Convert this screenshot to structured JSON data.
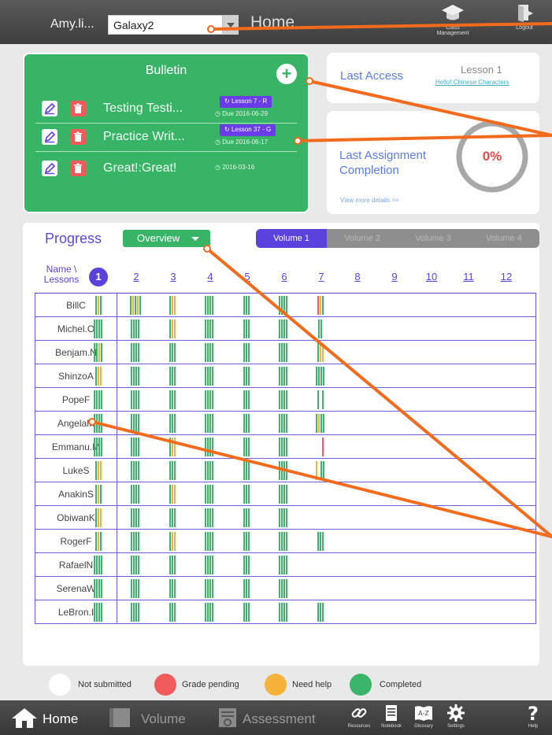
{
  "header": {
    "user_name": "Amy.li...",
    "class_select": "Galaxy2",
    "title": "Home",
    "class_management_label": "Class Management",
    "logout_label": "Logout"
  },
  "bulletin": {
    "title": "Bulletin",
    "add_label": "+",
    "items": [
      {
        "text": "Testing Testi...",
        "tag": "Lesson 7 - R",
        "due": "Due 2016-06-29"
      },
      {
        "text": "Practice Writ...",
        "tag": "Lesson 37 - G",
        "due": "Due 2016-06-17"
      },
      {
        "text": "Great!:Great!",
        "tag": "",
        "due": "2016-03-16"
      }
    ]
  },
  "last_access": {
    "label": "Last Access",
    "lesson": "Lesson 1",
    "link": "Hello! Chinese Characters"
  },
  "last_assignment": {
    "label": "Last Assignment Completion",
    "percent": "0%",
    "completion_fraction": 0,
    "more_link": "View more details >>"
  },
  "progress": {
    "title": "Progress",
    "view_select": "Overview",
    "volumes": [
      "Volume 1",
      "Volume 2",
      "Volume 3",
      "Volume 4"
    ],
    "active_volume": 0,
    "name_header": "Name \\ Lessons",
    "lessons": [
      "1",
      "2",
      "3",
      "4",
      "5",
      "6",
      "7",
      "8",
      "9",
      "10",
      "11",
      "12"
    ],
    "active_lesson": 0,
    "students": [
      {
        "name": "BillC",
        "bars": [
          "gyg",
          "gygyg",
          "gyy",
          "gggg",
          "ggg",
          "gggg",
          "ryg"
        ]
      },
      {
        "name": "Michel.O",
        "bars": [
          "gggg",
          "gggg",
          "gyy",
          "gggg",
          "ggg",
          "gggg",
          "gg"
        ]
      },
      {
        "name": "Benjam.N",
        "bars": [
          "ggyg",
          "gggg",
          "ggg",
          "gggg",
          "ggg",
          "gggg",
          "gyy"
        ]
      },
      {
        "name": "ShinzoA",
        "bars": [
          "gyy",
          "gggg",
          "ggg",
          "gggg",
          "ggg",
          "gggg",
          "gggg"
        ]
      },
      {
        "name": "PopeF",
        "bars": [
          "gggg",
          "gggg",
          "ggg",
          "gggg",
          "ggg",
          "gggg",
          "g-g"
        ]
      },
      {
        "name": "AngelaM",
        "bars": [
          "gggg",
          "gggg",
          "ggg",
          "gggg",
          "ggg",
          "gggg",
          "gygg"
        ]
      },
      {
        "name": "Emmanu.M",
        "bars": [
          "gggg",
          "gggg",
          "gyy",
          "gggg",
          "ggg",
          "gggg",
          "--r"
        ]
      },
      {
        "name": "LukeS",
        "bars": [
          "gyy",
          "gggg",
          "ggg",
          "gggg",
          "ggg",
          "gggg",
          "y-gg"
        ]
      },
      {
        "name": "AnakinS",
        "bars": [
          "gyg",
          "gggg",
          "gyy",
          "gggg",
          "ggg",
          "gggg",
          ""
        ]
      },
      {
        "name": "ObiwanK",
        "bars": [
          "gyy",
          "gggg",
          "ggg",
          "gggg",
          "ggg",
          "gggg",
          ""
        ]
      },
      {
        "name": "RogerF",
        "bars": [
          "gyg",
          "gggg",
          "gyy",
          "gggg",
          "ggg",
          "gggg",
          "ggg"
        ]
      },
      {
        "name": "RafaelN",
        "bars": [
          "gggg",
          "gggg",
          "ggg",
          "gggg",
          "ggg",
          "gggg",
          ""
        ]
      },
      {
        "name": "SerenaW",
        "bars": [
          "gggg",
          "gggg",
          "ggg",
          "gggg",
          "ggg",
          "gggg",
          ""
        ]
      },
      {
        "name": "LeBron.I",
        "bars": [
          "gggg",
          "gggg",
          "ggg",
          "gggg",
          "ggg",
          "gggg",
          "ggg"
        ]
      }
    ]
  },
  "legend": [
    {
      "label": "Not submitted",
      "color": "#ffffff"
    },
    {
      "label": "Grade pending",
      "color": "#f25b5b"
    },
    {
      "label": "Need help",
      "color": "#f6b33a"
    },
    {
      "label": "Completed",
      "color": "#3ab569"
    }
  ],
  "status_colors": {
    "g": "#3ab569",
    "y": "#f6b33a",
    "r": "#f25b5b"
  },
  "accent_color": "#5b42dc",
  "callout_color": "#f26b1d",
  "nav": {
    "home": "Home",
    "volume": "Volume",
    "assessment": "Assessment",
    "tools": [
      "Resources",
      "Notebook",
      "Glossary",
      "Settings",
      "Help"
    ]
  },
  "icons": [
    "pencil-icon",
    "trash-icon",
    "link-icon",
    "clock-icon",
    "mortarboard-icon",
    "logout-icon",
    "home-icon",
    "book-icon",
    "assessment-icon",
    "gear-icon",
    "help-icon"
  ]
}
